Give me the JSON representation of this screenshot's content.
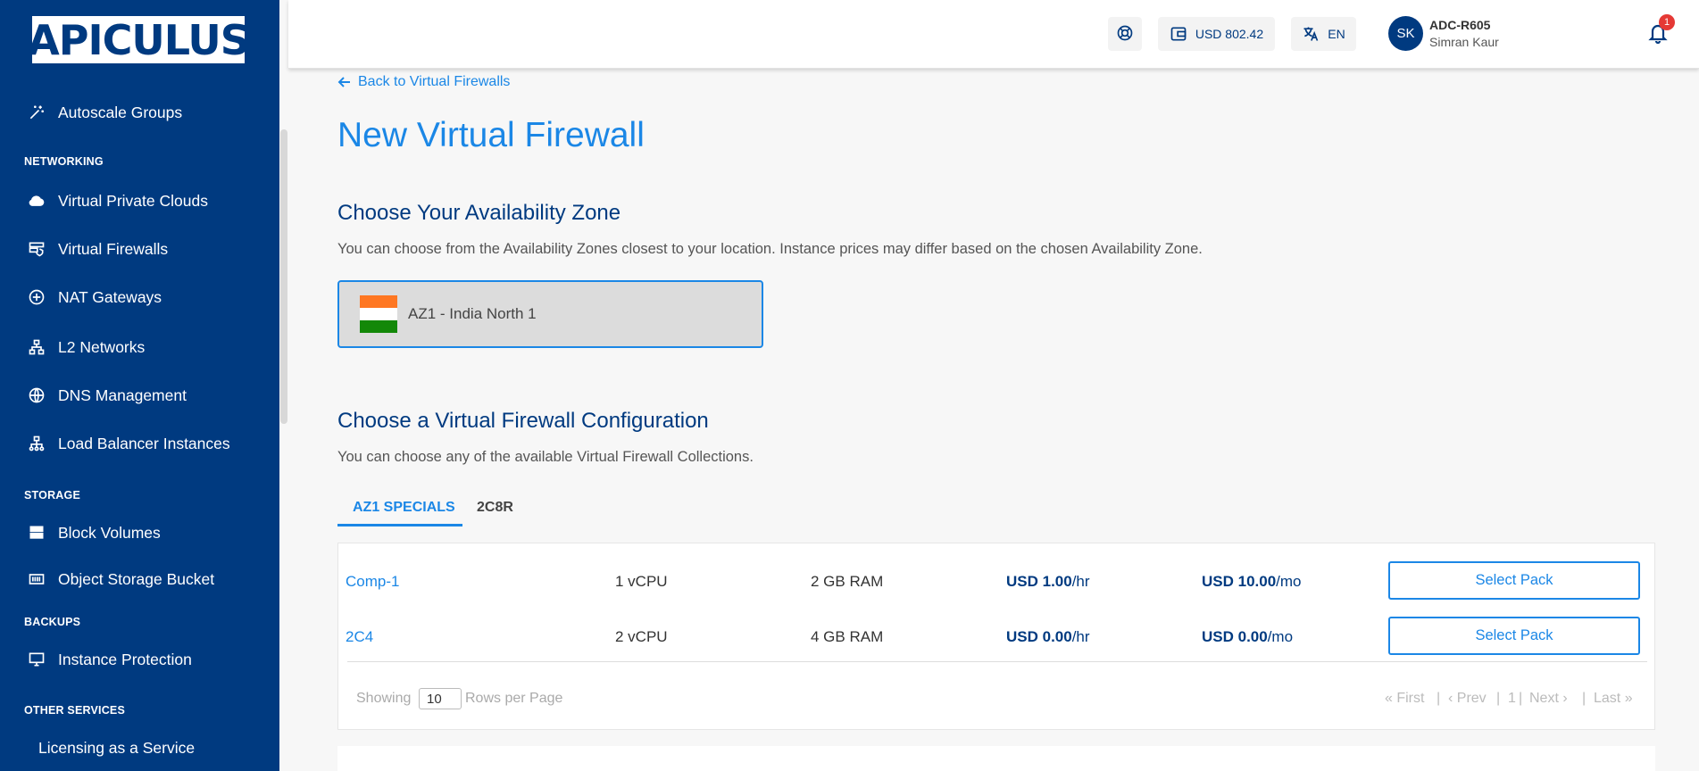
{
  "logo": {
    "text": "APICULUS"
  },
  "sidebar": {
    "items_top": [
      {
        "label": "Autoscale Groups",
        "icon": "magic-wand-icon"
      }
    ],
    "sections": [
      {
        "title": "NETWORKING",
        "items": [
          {
            "label": "Virtual Private Clouds",
            "icon": "cloud-icon"
          },
          {
            "label": "Virtual Firewalls",
            "icon": "firewall-icon"
          },
          {
            "label": "NAT Gateways",
            "icon": "nat-icon"
          },
          {
            "label": "L2 Networks",
            "icon": "network-tree-icon"
          },
          {
            "label": "DNS Management",
            "icon": "globe-icon"
          },
          {
            "label": "Load Balancer Instances",
            "icon": "load-balancer-icon"
          }
        ]
      },
      {
        "title": "STORAGE",
        "items": [
          {
            "label": "Block Volumes",
            "icon": "block-storage-icon"
          },
          {
            "label": "Object Storage Bucket",
            "icon": "bucket-icon"
          }
        ]
      },
      {
        "title": "BACKUPS",
        "items": [
          {
            "label": "Instance Protection",
            "icon": "monitor-shield-icon"
          }
        ]
      },
      {
        "title": "OTHER SERVICES",
        "items": [
          {
            "label": "Licensing as a Service",
            "icon": ""
          }
        ]
      }
    ]
  },
  "header": {
    "balance": "USD 802.42",
    "language": "EN",
    "avatar_initials": "SK",
    "account_id": "ADC-R605",
    "user_name": "Simran Kaur",
    "notification_count": "1"
  },
  "main": {
    "back_link": "Back to Virtual Firewalls",
    "title": "New Virtual Firewall",
    "az_section": {
      "title": "Choose Your Availability Zone",
      "description": "You can choose from the Availability Zones closest to your location. Instance prices may differ based on the chosen Availability Zone.",
      "zone_label": "AZ1 - India North 1",
      "flag_colors": [
        "#ff7722",
        "#ffffff",
        "#138808"
      ]
    },
    "config_section": {
      "title": "Choose a Virtual Firewall Configuration",
      "description": "You can choose any of the available Virtual Firewall Collections.",
      "tabs": [
        "AZ1 SPECIALS",
        "2C8R"
      ]
    },
    "table": {
      "rows": [
        {
          "name": "Comp-1",
          "cpu": "1 vCPU",
          "ram": "2 GB RAM",
          "hourly": "USD 1.00",
          "hourly_unit": "/hr",
          "monthly": "USD 10.00",
          "monthly_unit": "/mo",
          "button": "Select Pack"
        },
        {
          "name": "2C4",
          "cpu": "2 vCPU",
          "ram": "4 GB RAM",
          "hourly": "USD 0.00",
          "hourly_unit": "/hr",
          "monthly": "USD 0.00",
          "monthly_unit": "/mo",
          "button": "Select Pack"
        }
      ],
      "pager": {
        "showing": "Showing",
        "rows_value": "10",
        "rows_per_page": "Rows per Page",
        "first": "« First",
        "prev": "‹ Prev",
        "current": "1",
        "next": "Next ›",
        "last": "Last »"
      }
    }
  },
  "colors": {
    "sidebar": "#003a80",
    "accent": "#1b87e6",
    "badge": "#e53935"
  }
}
